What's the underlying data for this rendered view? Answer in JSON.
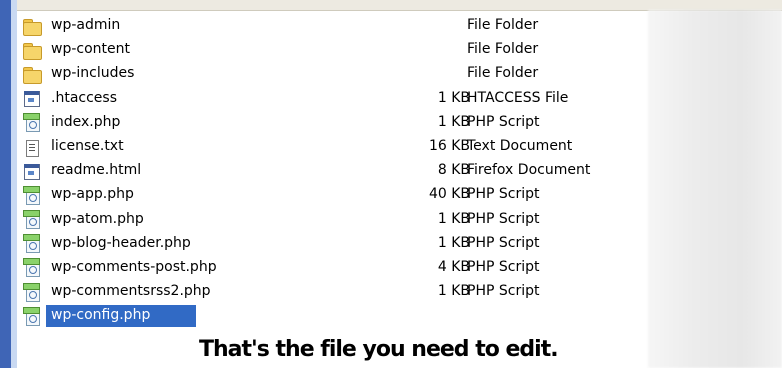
{
  "files": [
    {
      "name": "wp-admin",
      "size": "",
      "type": "File Folder",
      "icon": "folder-icon"
    },
    {
      "name": "wp-content",
      "size": "",
      "type": "File Folder",
      "icon": "folder-icon"
    },
    {
      "name": "wp-includes",
      "size": "",
      "type": "File Folder",
      "icon": "folder-icon"
    },
    {
      "name": ".htaccess",
      "size": "1 KB",
      "type": "HTACCESS File",
      "icon": "web-icon"
    },
    {
      "name": "index.php",
      "size": "1 KB",
      "type": "PHP Script",
      "icon": "php-icon"
    },
    {
      "name": "license.txt",
      "size": "16 KB",
      "type": "Text Document",
      "icon": "txt-icon"
    },
    {
      "name": "readme.html",
      "size": "8 KB",
      "type": "Firefox Document",
      "icon": "web-icon"
    },
    {
      "name": "wp-app.php",
      "size": "40 KB",
      "type": "PHP Script",
      "icon": "php-icon"
    },
    {
      "name": "wp-atom.php",
      "size": "1 KB",
      "type": "PHP Script",
      "icon": "php-icon"
    },
    {
      "name": "wp-blog-header.php",
      "size": "1 KB",
      "type": "PHP Script",
      "icon": "php-icon"
    },
    {
      "name": "wp-comments-post.php",
      "size": "4 KB",
      "type": "PHP Script",
      "icon": "php-icon"
    },
    {
      "name": "wp-commentsrss2.php",
      "size": "1 KB",
      "type": "PHP Script",
      "icon": "php-icon"
    },
    {
      "name": "wp-config.php",
      "size": "",
      "type": "",
      "icon": "php-icon",
      "selected": true
    }
  ],
  "caption": "That's the file you need to edit.",
  "colors": {
    "selection": "#316ac5",
    "sidebar": "#3f65b6"
  }
}
